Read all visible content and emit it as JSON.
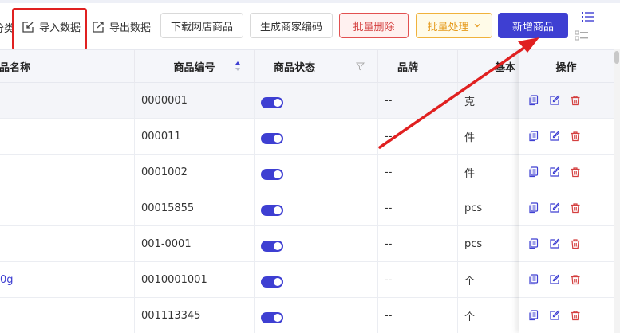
{
  "toolbar": {
    "category_label": "分类",
    "import_label": "导入数据",
    "export_label": "导出数据",
    "download_label": "下载网店商品",
    "generate_label": "生成商家编码",
    "batch_delete_label": "批量删除",
    "batch_process_label": "批量处理",
    "add_label": "新增商品"
  },
  "table": {
    "columns": [
      "商品名称",
      "商品编号",
      "商品状态",
      "品牌",
      "基本",
      "操作"
    ],
    "rows": [
      {
        "name": "",
        "code": "0000001",
        "brand": "--",
        "unit": "克"
      },
      {
        "name": "",
        "code": "000011",
        "brand": "--",
        "unit": "件"
      },
      {
        "name": "",
        "code": "0001002",
        "brand": "--",
        "unit": "件"
      },
      {
        "name": "",
        "code": "00015855",
        "brand": "--",
        "unit": "pcs"
      },
      {
        "name": "",
        "code": "001-0001",
        "brand": "--",
        "unit": "pcs"
      },
      {
        "name": "0g",
        "code": "0010001001",
        "brand": "--",
        "unit": "个"
      },
      {
        "name": "",
        "code": "001113345",
        "brand": "--",
        "unit": "个"
      }
    ]
  },
  "colors": {
    "primary": "#3e3fd2",
    "danger": "#d43f3f",
    "warning": "#e59a1c",
    "annotation": "#e02020"
  }
}
